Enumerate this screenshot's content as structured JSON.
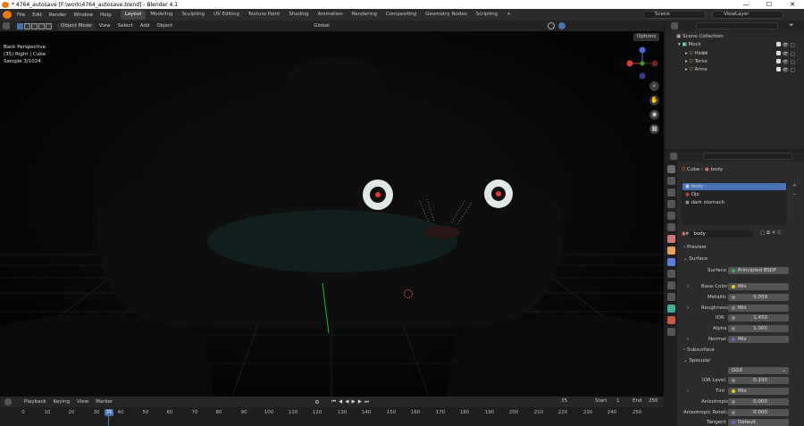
{
  "window": {
    "title": "* 4764_autosave [F:\\work\\4764_autosave.blend] - Blender 4.1",
    "minimize": "—",
    "maximize": "☐",
    "close": "✕"
  },
  "menu": [
    "File",
    "Edit",
    "Render",
    "Window",
    "Help"
  ],
  "workspaces": [
    "Layout",
    "Modeling",
    "Sculpting",
    "UV Editing",
    "Texture Paint",
    "Shading",
    "Animation",
    "Rendering",
    "Compositing",
    "Geometry Nodes",
    "Scripting"
  ],
  "add_workspace": "+",
  "scene": {
    "label": "Scene"
  },
  "view_layer": {
    "label": "ViewLayer"
  },
  "viewport_header": {
    "mode": "Object Mode",
    "menus": [
      "View",
      "Select",
      "Add",
      "Object"
    ],
    "transform": "Global",
    "options": "Options"
  },
  "viewport_info": [
    "Back Perspective",
    "(35) Right | Cube",
    "Sample 3/1024"
  ],
  "timeline": {
    "menus": [
      "Playback",
      "Keying",
      "View",
      "Marker"
    ],
    "current_frame": "35",
    "start_label": "Start",
    "start": "1",
    "end_label": "End",
    "end": "250",
    "ruler": [
      "0",
      "10",
      "20",
      "30",
      "40",
      "50",
      "60",
      "70",
      "80",
      "90",
      "100",
      "110",
      "120",
      "130",
      "140",
      "150",
      "160",
      "170",
      "180",
      "190",
      "200",
      "210",
      "220",
      "230",
      "240",
      "250"
    ],
    "playhead": "35"
  },
  "outliner": {
    "search_placeholder": "",
    "root": "Scene Collection",
    "collection": "Mock",
    "items": [
      "Head",
      "Torso",
      "Arms"
    ]
  },
  "properties": {
    "search_placeholder": "",
    "breadcrumb_object": "Cube",
    "breadcrumb_material": "body",
    "materials": [
      {
        "name": "body",
        "color": "#4772b3",
        "selected": true
      },
      {
        "name": "Ojo",
        "color": "#c43c3c",
        "selected": false
      },
      {
        "name": "dark stomach",
        "color": "#8a8a8a",
        "selected": false
      }
    ],
    "material_name": "body",
    "preview": "Preview",
    "surface": "Surface",
    "surface_row": {
      "label": "Surface",
      "value": "Principled BSDF"
    },
    "fields": [
      {
        "label": "Base Color",
        "value": "Mix",
        "expand": true
      },
      {
        "label": "Metallic",
        "value": "0.059",
        "expand": false
      },
      {
        "label": "Roughness",
        "value": "Mix",
        "expand": true
      },
      {
        "label": "IOR",
        "value": "1.450",
        "expand": false
      },
      {
        "label": "Alpha",
        "value": "1.000",
        "expand": false
      },
      {
        "label": "Normal",
        "value": "Mix",
        "expand": true
      }
    ],
    "subsurface": "Subsurface",
    "specular": "Specular",
    "specular_fields": [
      {
        "label": "",
        "value": "GGX",
        "expand": false
      },
      {
        "label": "IOR Level",
        "value": "0.150",
        "expand": false
      },
      {
        "label": "Tint",
        "value": "Mix",
        "expand": true
      },
      {
        "label": "Anisotropic",
        "value": "0.000",
        "expand": false
      },
      {
        "label": "Anisotropic Rotati...",
        "value": "0.000",
        "expand": false
      },
      {
        "label": "Tangent",
        "value": "Default",
        "expand": false
      }
    ]
  }
}
